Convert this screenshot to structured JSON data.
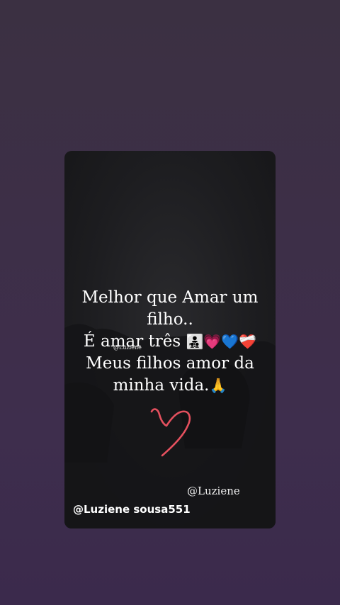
{
  "story": {
    "lines": [
      "Melhor que Amar um",
      "filho..",
      "É amar três",
      "Meus filhos amor da",
      "minha vida."
    ],
    "emoji_line3": "👨‍👧‍👦💗💙❤️‍🩹",
    "emoji_line5": "🙏",
    "small_watermark": "@Luziene",
    "signature": "@Luziene",
    "username": "@Luziene sousa551"
  },
  "colors": {
    "background_top": "#3b3042",
    "background_bottom": "#3b2a4c",
    "card": "#1d1d20",
    "heart_doodle": "#e4505e",
    "text": "#ffffff"
  },
  "icons": {
    "heart_doodle": "heart-doodle-icon"
  }
}
